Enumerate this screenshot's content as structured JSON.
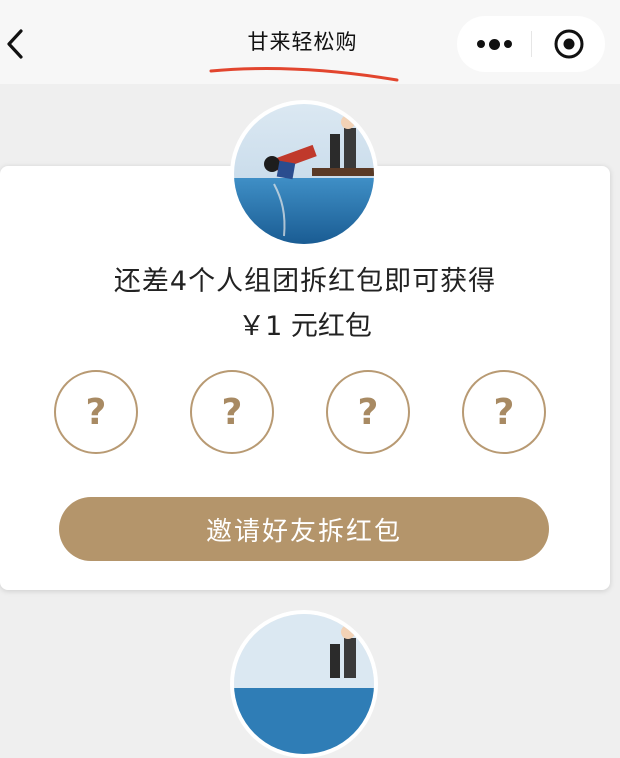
{
  "nav": {
    "title": "甘来轻松购",
    "back_icon": "chevron-left-icon",
    "more_icon": "more-dots-icon",
    "close_icon": "target-close-icon",
    "annotation_color": "#e2452e"
  },
  "card": {
    "headline": "还差4个人组团拆红包即可获得",
    "amount": "￥1 元红包",
    "slots": [
      "?",
      "?",
      "?",
      "?"
    ],
    "invite_button": "邀请好友拆红包",
    "accent_color": "#b4956b"
  }
}
